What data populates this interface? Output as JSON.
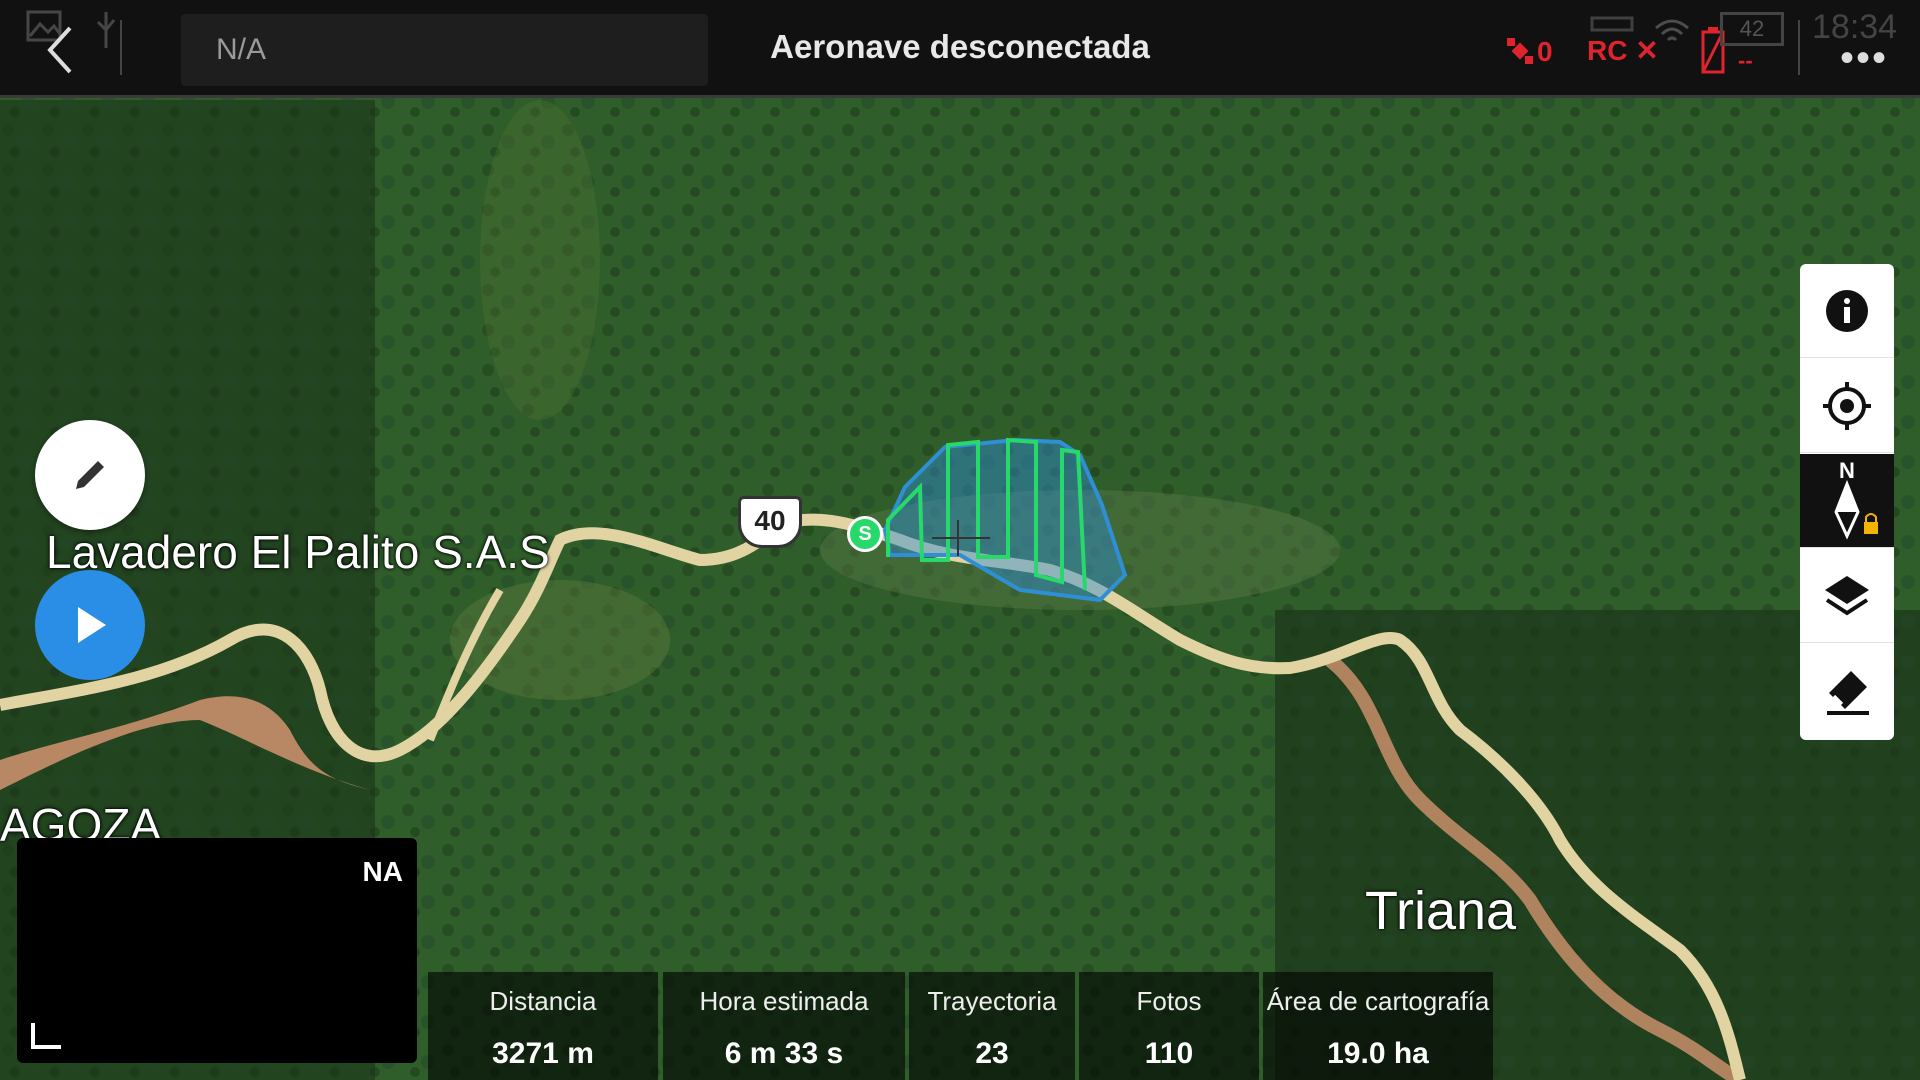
{
  "topbar": {
    "mission_name": "N/A",
    "status_title": "Aeronave desconectada",
    "gps_count": "0",
    "rc_label": "RC ✕",
    "drone_battery": "--",
    "rc_battery": "42",
    "clock": "18:34",
    "more": "•••"
  },
  "map_labels": {
    "poi": "Lavadero El Palito S.A.S",
    "town_left": "AGOZA",
    "town_right": "Triana",
    "route_shield": "40",
    "start_marker": "S"
  },
  "camera": {
    "status": "NA"
  },
  "stats": [
    {
      "label": "Distancia",
      "value": "3271 m"
    },
    {
      "label": "Hora estimada",
      "value": "6 m 33 s"
    },
    {
      "label": "Trayectoria",
      "value": "23"
    },
    {
      "label": "Fotos",
      "value": "110"
    },
    {
      "label": "Área de cartografía",
      "value": "19.0 ha"
    }
  ],
  "toolbar": {
    "icons": [
      "info-icon",
      "locate-icon",
      "compass-north-lock-icon",
      "layers-icon",
      "eraser-icon"
    ],
    "north_label": "N"
  },
  "colors": {
    "area_fill": "#2f8fd6",
    "flight_path": "#27d86a",
    "road": "#e2d3a2",
    "river": "#c98f6b",
    "toolbar_active": "#111111",
    "warning": "#e0242c",
    "play": "#2a8de6"
  }
}
